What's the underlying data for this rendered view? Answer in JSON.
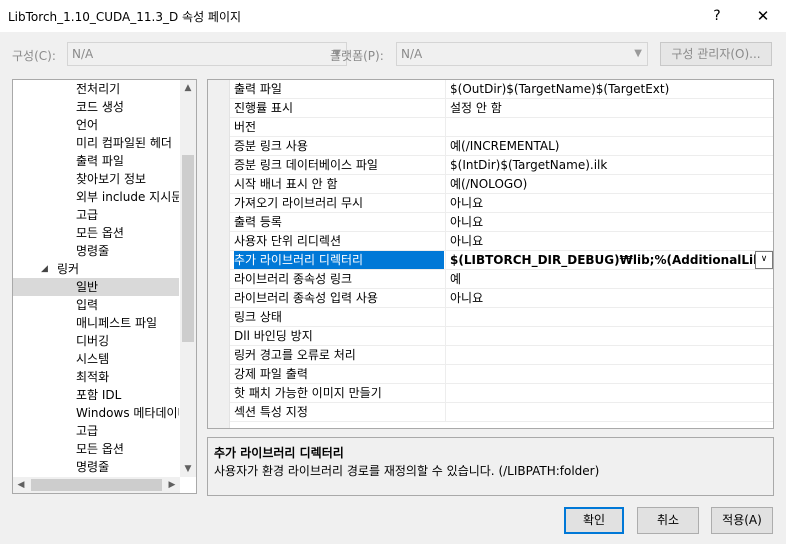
{
  "window": {
    "title": "LibTorch_1.10_CUDA_11.3_D 속성 페이지",
    "help_label": "?",
    "close_label": "✕"
  },
  "toolbar": {
    "config_label": "구성(C):",
    "config_value": "N/A",
    "platform_label": "플랫폼(P):",
    "platform_value": "N/A",
    "config_manager_label": "구성 관리자(O)..."
  },
  "tree": {
    "items": [
      {
        "label": "전처리기"
      },
      {
        "label": "코드 생성"
      },
      {
        "label": "언어"
      },
      {
        "label": "미리 컴파일된 헤더"
      },
      {
        "label": "출력 파일"
      },
      {
        "label": "찾아보기 정보"
      },
      {
        "label": "외부 include 지시문"
      },
      {
        "label": "고급"
      },
      {
        "label": "모든 옵션"
      },
      {
        "label": "명령줄"
      },
      {
        "label": "링커"
      },
      {
        "label": "일반"
      },
      {
        "label": "입력"
      },
      {
        "label": "매니페스트 파일"
      },
      {
        "label": "디버깅"
      },
      {
        "label": "시스템"
      },
      {
        "label": "최적화"
      },
      {
        "label": "포함 IDL"
      },
      {
        "label": "Windows 메타데이터"
      },
      {
        "label": "고급"
      },
      {
        "label": "모든 옵션"
      },
      {
        "label": "명령줄"
      }
    ]
  },
  "properties": {
    "rows": [
      {
        "name": "출력 파일",
        "value": "$(OutDir)$(TargetName)$(TargetExt)"
      },
      {
        "name": "진행률 표시",
        "value": "설정 안 함"
      },
      {
        "name": "버전",
        "value": ""
      },
      {
        "name": "증분 링크 사용",
        "value": "예(/INCREMENTAL)"
      },
      {
        "name": "증분 링크 데이터베이스 파일",
        "value": "$(IntDir)$(TargetName).ilk"
      },
      {
        "name": "시작 배너 표시 안 함",
        "value": "예(/NOLOGO)"
      },
      {
        "name": "가져오기 라이브러리 무시",
        "value": "아니요"
      },
      {
        "name": "출력 등록",
        "value": "아니요"
      },
      {
        "name": "사용자 단위 리디렉션",
        "value": "아니요"
      },
      {
        "name": "추가 라이브러리 디렉터리",
        "value": "$(LIBTORCH_DIR_DEBUG)₩lib;%(AdditionalLibraryDirectories)"
      },
      {
        "name": "라이브러리 종속성 링크",
        "value": "예"
      },
      {
        "name": "라이브러리 종속성 입력 사용",
        "value": "아니요"
      },
      {
        "name": "링크 상태",
        "value": ""
      },
      {
        "name": "Dll 바인딩 방지",
        "value": ""
      },
      {
        "name": "링커 경고를 오류로 처리",
        "value": ""
      },
      {
        "name": "강제 파일 출력",
        "value": ""
      },
      {
        "name": "핫 패치 가능한 이미지 만들기",
        "value": ""
      },
      {
        "name": "섹션 특성 지정",
        "value": ""
      }
    ]
  },
  "description": {
    "title": "추가 라이브러리 디렉터리",
    "text": "사용자가 환경 라이브러리 경로를 재정의할 수 있습니다. (/LIBPATH:folder)"
  },
  "buttons": {
    "ok": "확인",
    "cancel": "취소",
    "apply": "적용(A)"
  },
  "colors": {
    "selection": "#0078d7",
    "tree_selection": "#d9d9d9"
  }
}
